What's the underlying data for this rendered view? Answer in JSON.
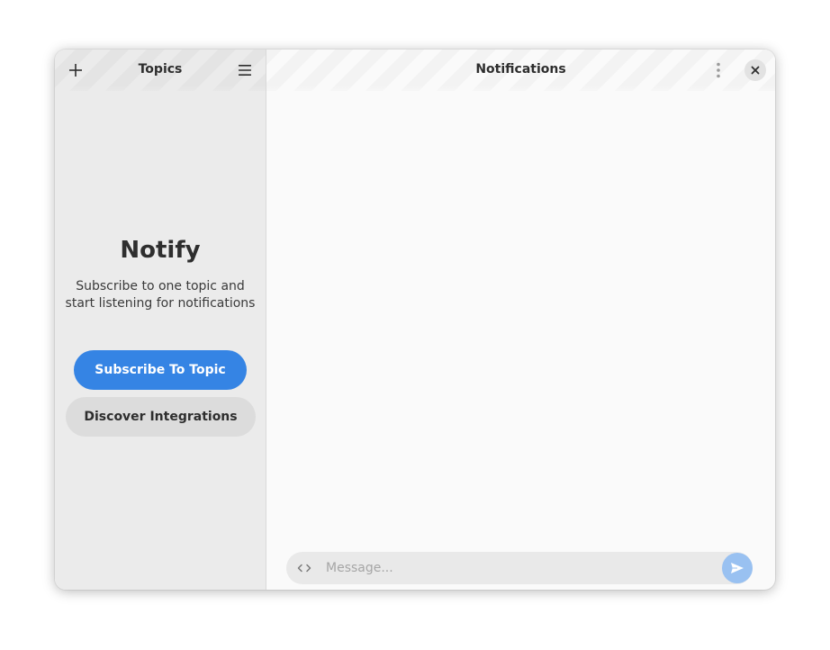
{
  "sidebar": {
    "title": "Topics",
    "add_icon": "plus-icon",
    "menu_icon": "hamburger-menu-icon",
    "empty_state": {
      "title": "Notify",
      "description": "Subscribe to one topic and start listening for notifications"
    },
    "subscribe_button": "Subscribe To Topic",
    "discover_button": "Discover Integrations"
  },
  "main": {
    "title": "Notifications",
    "more_icon": "vertical-dots-icon",
    "close_icon": "close-icon",
    "composer": {
      "code_icon": "code-icon",
      "placeholder": "Message...",
      "value": "",
      "send_icon": "send-icon"
    }
  },
  "colors": {
    "accent": "#3584e4",
    "send_disabled": "#99c1f1",
    "sidebar_bg": "#ebebeb",
    "content_bg": "#fafafa"
  }
}
